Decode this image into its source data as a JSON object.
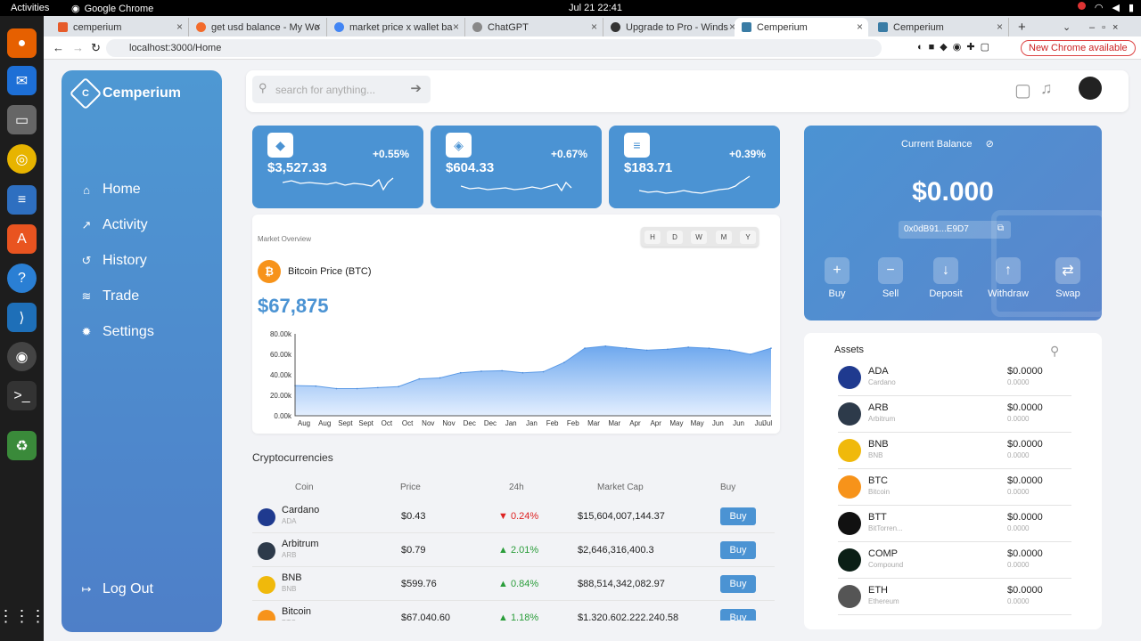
{
  "os": {
    "activities": "Activities",
    "app_name": "Google Chrome",
    "clock": "Jul 21  22:41"
  },
  "tabs": [
    "cemperium",
    "get usd balance - My Wo",
    "market price x wallet ba",
    "ChatGPT",
    "Upgrade to Pro - Winds",
    "Cemperium",
    "Cemperium"
  ],
  "browser": {
    "url": "localhost:3000/Home",
    "new_chrome": "New Chrome available"
  },
  "brand": "Cemperium",
  "nav": [
    "Home",
    "Activity",
    "History",
    "Trade",
    "Settings"
  ],
  "logout": "Log Out",
  "search_placeholder": "search for anything...",
  "tickers": [
    {
      "icon": "ethereum-icon",
      "price": "$3,527.33",
      "change": "+0.55%"
    },
    {
      "icon": "bnb-icon",
      "price": "$604.33",
      "change": "+0.67%"
    },
    {
      "icon": "solana-icon",
      "price": "$183.71",
      "change": "+0.39%"
    }
  ],
  "market": {
    "label": "Market Overview",
    "timeframes": [
      "H",
      "D",
      "W",
      "M",
      "Y"
    ],
    "coin_title": "Bitcoin Price (BTC)",
    "price": "$67,875"
  },
  "chart_data": {
    "type": "area",
    "x": [
      "Aug",
      "Aug",
      "Sept",
      "Sept",
      "Oct",
      "Oct",
      "Nov",
      "Nov",
      "Dec",
      "Dec",
      "Jan",
      "Jan",
      "Feb",
      "Feb",
      "Mar",
      "Mar",
      "Apr",
      "Apr",
      "May",
      "May",
      "Jun",
      "Jun",
      "Jul",
      "Jul"
    ],
    "values": [
      29500,
      29000,
      26500,
      26500,
      27500,
      28500,
      36000,
      37000,
      42000,
      43500,
      44000,
      42000,
      43000,
      52000,
      66000,
      68000,
      66000,
      64000,
      65000,
      67000,
      66000,
      64000,
      60000,
      66000
    ],
    "yticks": [
      "0.00k",
      "20.00k",
      "40.00k",
      "60.00k",
      "80.00k"
    ],
    "ylim": [
      0,
      80000
    ]
  },
  "crypto": {
    "title": "Cryptocurrencies",
    "headers": [
      "Coin",
      "Price",
      "24h",
      "Market Cap",
      "Buy"
    ],
    "rows": [
      {
        "name": "Cardano",
        "symbol": "ADA",
        "price": "$0.43",
        "change": "▼ 0.24%",
        "cap": "$15,604,007,144.37",
        "buy": "Buy",
        "color": "#1f3a8f"
      },
      {
        "name": "Arbitrum",
        "symbol": "ARB",
        "price": "$0.79",
        "change": "▲ 2.01%",
        "cap": "$2,646,316,400.3",
        "buy": "Buy",
        "color": "#2d3a4a"
      },
      {
        "name": "BNB",
        "symbol": "BNB",
        "price": "$599.76",
        "change": "▲ 0.84%",
        "cap": "$88,514,342,082.97",
        "buy": "Buy",
        "color": "#f0b90b"
      },
      {
        "name": "Bitcoin",
        "symbol": "BTC",
        "price": "$67,040.60",
        "change": "▲ 1.18%",
        "cap": "$1,320,602,222,240.58",
        "buy": "Buy",
        "color": "#f7931a"
      }
    ]
  },
  "balance": {
    "label": "Current Balance",
    "amount": "$0.000",
    "address": "0x0dB91...E9D7",
    "actions": [
      "Buy",
      "Sell",
      "Deposit",
      "Withdraw",
      "Swap"
    ]
  },
  "assets": {
    "title": "Assets",
    "items": [
      {
        "sym": "ADA",
        "name": "Cardano",
        "usd": "$0.0000",
        "amt": "0.0000",
        "color": "#1f3a8f"
      },
      {
        "sym": "ARB",
        "name": "Arbitrum",
        "usd": "$0.0000",
        "amt": "0.0000",
        "color": "#2d3a4a"
      },
      {
        "sym": "BNB",
        "name": "BNB",
        "usd": "$0.0000",
        "amt": "0.0000",
        "color": "#f0b90b"
      },
      {
        "sym": "BTC",
        "name": "Bitcoin",
        "usd": "$0.0000",
        "amt": "0.0000",
        "color": "#f7931a"
      },
      {
        "sym": "BTT",
        "name": "BitTorren...",
        "usd": "$0.0000",
        "amt": "0.0000",
        "color": "#111"
      },
      {
        "sym": "COMP",
        "name": "Compound",
        "usd": "$0.0000",
        "amt": "0.0000",
        "color": "#0b1f16"
      },
      {
        "sym": "ETH",
        "name": "Ethereum",
        "usd": "$0.0000",
        "amt": "0.0000",
        "color": "#555"
      }
    ]
  }
}
